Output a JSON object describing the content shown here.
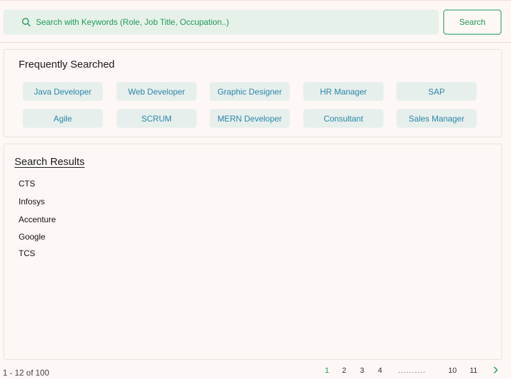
{
  "search": {
    "placeholder": "Search with Keywords (Role, Job Title, Occupation..)",
    "button_label": "Search",
    "icon": "search-icon"
  },
  "frequently_searched": {
    "title": "Frequently Searched",
    "chips": [
      "Java Developer",
      "Web Developer",
      "Graphic Designer",
      "HR Manager",
      "SAP",
      "Agile",
      "SCRUM",
      "MERN Developer",
      "Consultant",
      "Sales Manager"
    ]
  },
  "results": {
    "title": "Search Results",
    "items": [
      "CTS",
      "Infosys",
      "Accenture",
      "Google",
      "TCS"
    ]
  },
  "pagination": {
    "range_text": "1 - 12 of 100",
    "pages": [
      "1",
      "2",
      "3",
      "4"
    ],
    "dots": "..........",
    "last_pages": [
      "10",
      "11"
    ],
    "current": "1",
    "next_icon": "chevron-right-icon"
  },
  "colors": {
    "accent": "#1e9a57",
    "chip_text": "#2a85a8",
    "chip_bg": "#e6efec",
    "search_bg": "#e6f1e9",
    "page_bg": "#fdf7f5"
  }
}
